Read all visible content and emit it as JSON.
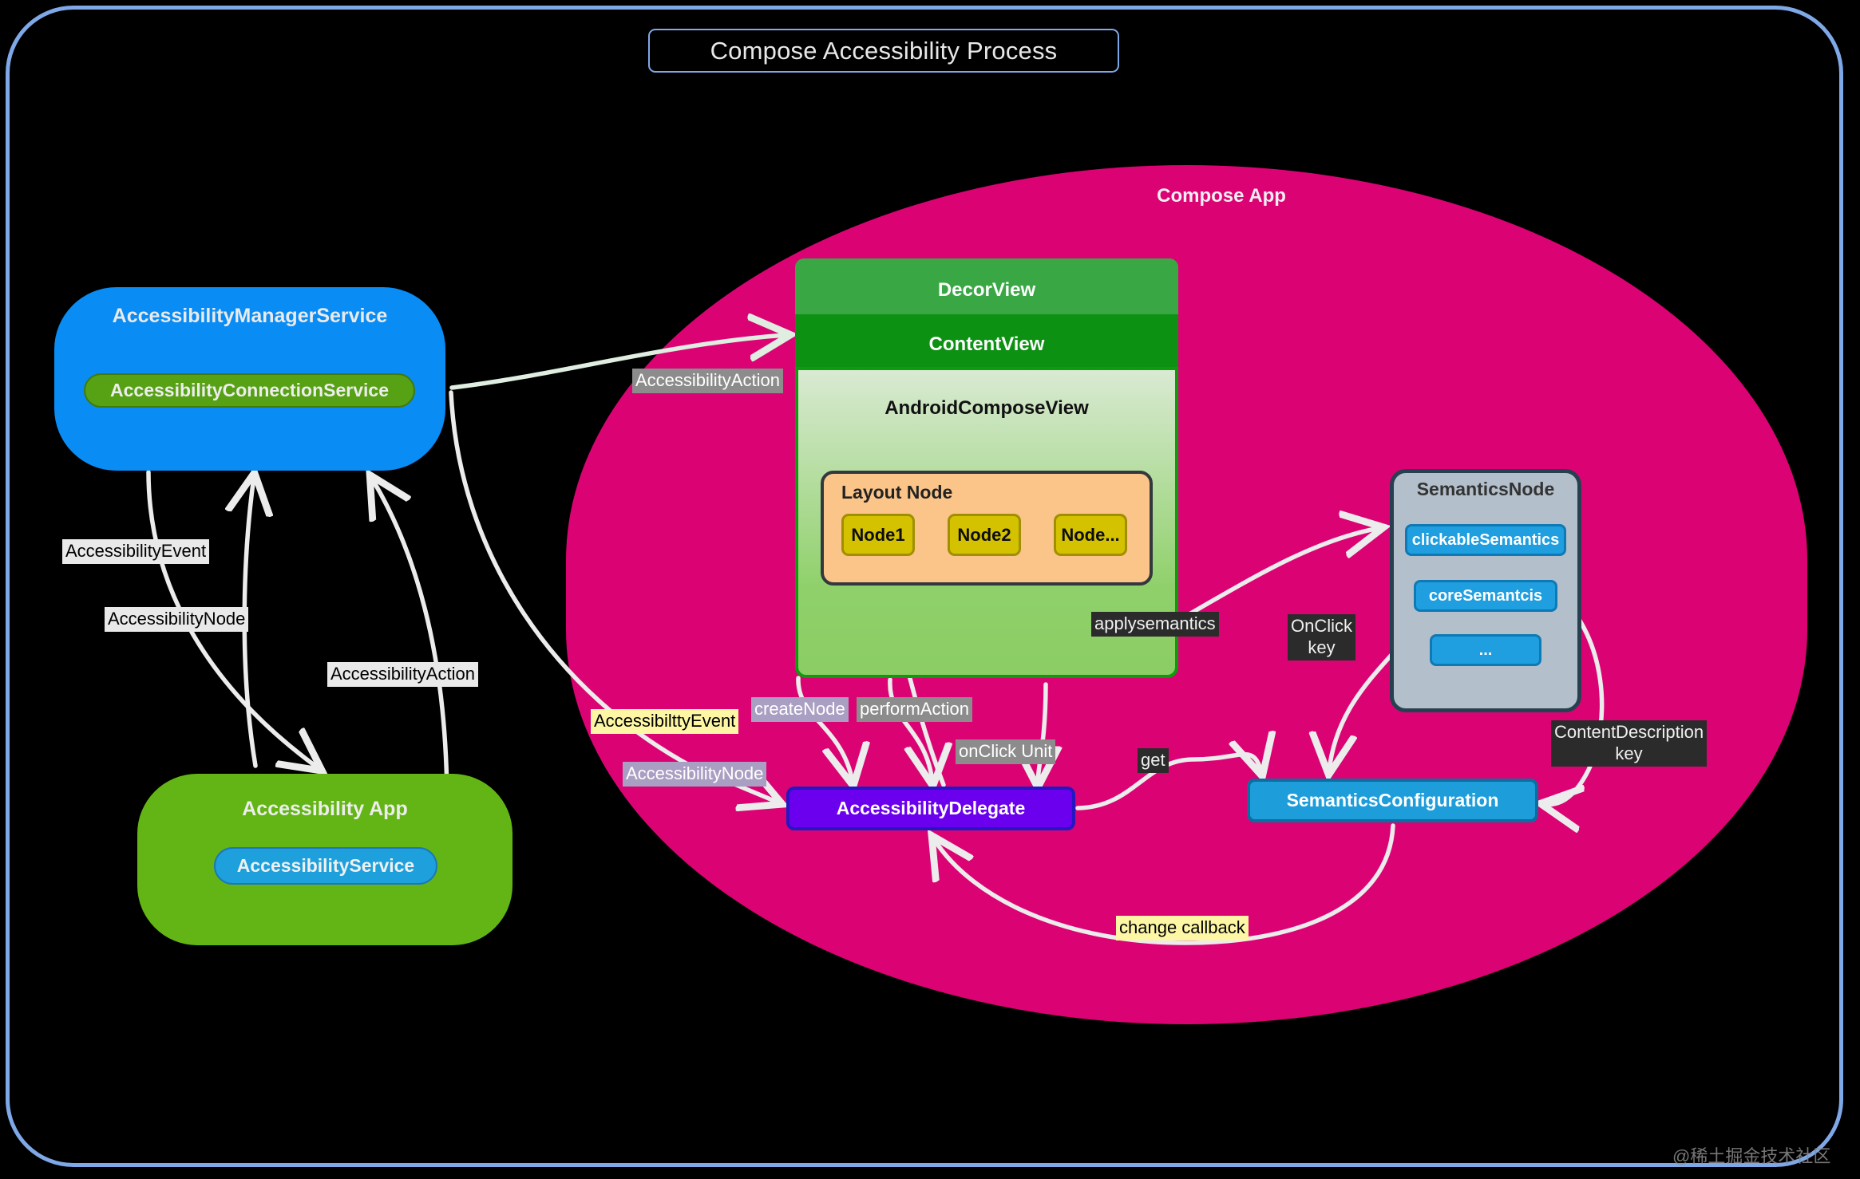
{
  "title": "Compose Accessibility Process",
  "watermark": "@稀土掘金技术社区",
  "compose_app": {
    "label": "Compose App"
  },
  "manager_service": {
    "title": "AccessibilityManagerService",
    "connection_service": "AccessibilityConnectionService"
  },
  "accessibility_app": {
    "title": "Accessibility App",
    "service": "AccessibilityService"
  },
  "view_stack": {
    "decor_view": "DecorView",
    "content_view": "ContentView",
    "android_compose_view": "AndroidComposeView",
    "layout_node": {
      "title": "Layout Node",
      "nodes": [
        "Node1",
        "Node2",
        "Node..."
      ]
    }
  },
  "semantics_node": {
    "title": "SemanticsNode",
    "items": [
      "clickableSemantics",
      "coreSemantcis",
      "..."
    ]
  },
  "delegate": "AccessibilityDelegate",
  "semantics_configuration": "SemanticsConfiguration",
  "edge_labels": {
    "accessibility_event": "AccessibilityEvent",
    "accessibility_node": "AccessibilityNode",
    "accessibility_action": "AccessibilityAction",
    "accessibility_action_compose": "AccessibilityAction",
    "accessibility_event_inner": "AccessibilttyEvent",
    "accessibility_node_inner": "AccessibilityNode",
    "create_node": "createNode",
    "perform_action": "performAction",
    "on_click_unit": "onClick Unit",
    "apply_semantics": "applysemantics",
    "on_click_key": "OnClick\nkey",
    "get": "get",
    "content_description_key": "ContentDescription\nkey",
    "change_callback": "change callback"
  },
  "colors": {
    "frame": "#7fa8e8",
    "blob": "#DB0373",
    "manager": "#0a8cf5",
    "connection": "#56a114",
    "app": "#63b516",
    "service": "#1ea0dd",
    "decor": "#3aa745",
    "content": "#0d9113",
    "compose_view": "#8fd06a",
    "layout_node": "#fbc58a",
    "node": "#d4c100",
    "semantics_node": "#b3c0cc",
    "semantics_item": "#1f9ee0",
    "delegate": "#6a00ee",
    "configuration": "#1e9ddb"
  }
}
